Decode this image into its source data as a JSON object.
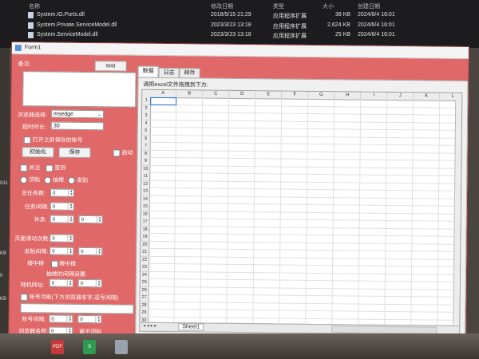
{
  "explorer": {
    "headers": {
      "name": "名称",
      "modified": "修改日期",
      "type": "类型",
      "size": "大小",
      "created": "创建日期"
    },
    "files": [
      {
        "name": "System.IO.Ports.dll",
        "modified": "2018/5/15 21:29",
        "type": "应用程序扩展",
        "size": "38 KB",
        "created": "2024/6/4 16:01"
      },
      {
        "name": "System.Private.ServiceModel.dll",
        "modified": "2023/3/23 13:18",
        "type": "应用程序扩展",
        "size": "2,624 KB",
        "created": "2024/6/4 16:01"
      },
      {
        "name": "System.ServiceModel.dll",
        "modified": "2023/3/23 13:18",
        "type": "应用程序扩展",
        "size": "25 KB",
        "created": "2024/6/4 16:01"
      }
    ],
    "side_fragments": [
      "GI1",
      "KB",
      "0",
      "KB"
    ]
  },
  "window": {
    "title": "Form1",
    "notes_label": "备注:",
    "test_button": "test",
    "browser_label": "浏览器选择:",
    "browser_value": "msedge",
    "timeout_label": "超时时长:",
    "timeout_value": "30",
    "open_saved_label": "打开之前保存的账号",
    "init_button": "初始化",
    "save_button": "保存",
    "start_label": "启动",
    "follow_label": "关注",
    "checkin_label": "签到",
    "radio_top": "顶贴",
    "radio_draft": "抽楼",
    "radio_post": "发贴",
    "total_tasks_label": "总任务数:",
    "task_interval_label": "任务间隔:",
    "rest_label": "休息:",
    "page_scroll_label": "页面滑动次数:",
    "post_interval_label": "发贴间隔:",
    "floor_label": "楼中楼",
    "floor_label2": "楼中楼",
    "floor_reply_label": "抽楼的间隔设置:",
    "random_url_label": "随机网址:",
    "account_switch_label": "账号功能(下方浏览器名字,逗号间隔)",
    "account_interval_label": "账号间隔:",
    "browser_name_label": "浏览器名称:",
    "no_top_label": "第不顶贴",
    "spin_zero": "0",
    "tabs": [
      "数据",
      "日志",
      "邮件"
    ],
    "panel_hint": "请把excel文件拖拽到下方:",
    "columns": [
      "A",
      "B",
      "C",
      "D",
      "E",
      "F",
      "G",
      "H",
      "I",
      "J",
      "K",
      "L"
    ],
    "rows": [
      "1",
      "2",
      "3",
      "4",
      "5",
      "6",
      "7",
      "8",
      "9",
      "10",
      "11",
      "12",
      "13",
      "14",
      "15",
      "16",
      "17",
      "18",
      "19",
      "20",
      "21",
      "22",
      "23",
      "24",
      "25",
      "26",
      "27",
      "28",
      "29",
      "30"
    ],
    "sheet_tab": "Sheet1"
  },
  "taskbar": {
    "icons": [
      "PDF",
      "S",
      ""
    ]
  }
}
